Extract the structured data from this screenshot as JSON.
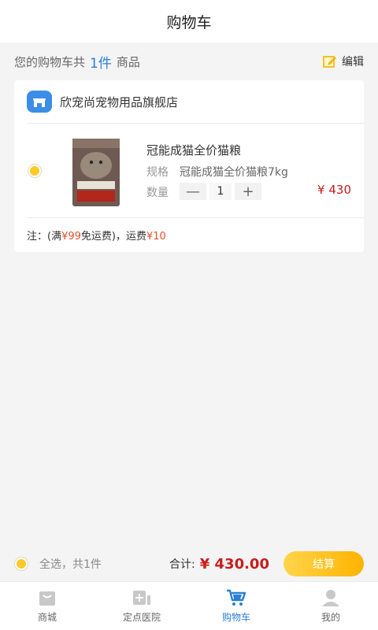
{
  "header": {
    "title": "购物车"
  },
  "summary": {
    "prefix": "您的购物车共",
    "count": "1件",
    "suffix": "商品",
    "edit_label": "编辑"
  },
  "shop": {
    "name": "欣宠尚宠物用品旗舰店"
  },
  "item": {
    "name": "冠能成猫全价猫粮",
    "spec_label": "规格",
    "spec_value": "冠能成猫全价猫粮7kg",
    "qty_label": "数量",
    "minus": "—",
    "qty": "1",
    "plus": "+",
    "price": "¥ 430"
  },
  "note": {
    "prefix": "注：(满",
    "threshold": "¥99",
    "middle": "免运费)，运费",
    "fee": "¥10"
  },
  "footer": {
    "select_all": "全选，共1件",
    "total_label": "合计:",
    "total_value": "¥ 430.00",
    "checkout_label": "结算"
  },
  "tabs": [
    {
      "label": "商城",
      "icon": "shop-bag-icon"
    },
    {
      "label": "定点医院",
      "icon": "hospital-icon"
    },
    {
      "label": "购物车",
      "icon": "cart-icon",
      "active": true
    },
    {
      "label": "我的",
      "icon": "profile-icon"
    }
  ],
  "colors": {
    "accent_blue": "#2b7fd4",
    "price_red": "#c81d1d",
    "checkout_yellow": "#ffc400",
    "note_orange": "#e8512f"
  }
}
